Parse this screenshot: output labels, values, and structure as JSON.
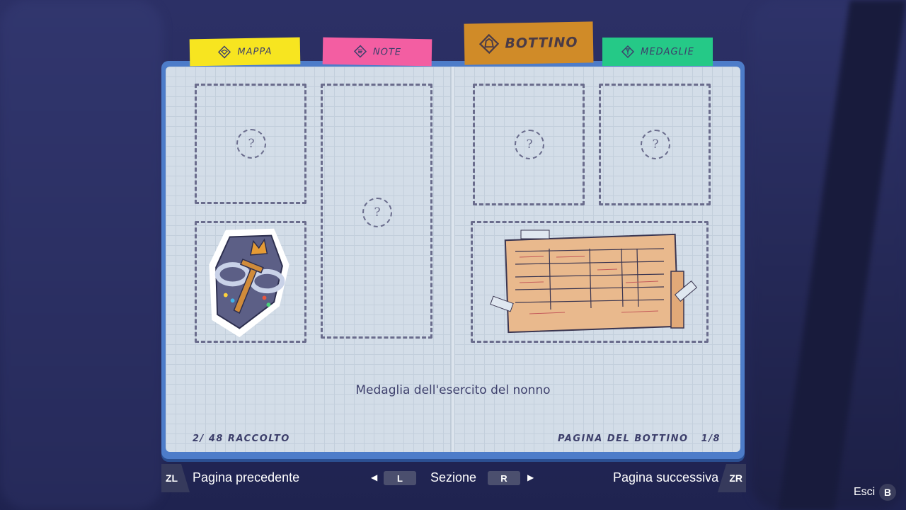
{
  "tabs": [
    {
      "label": "MAPPA",
      "icon": "map-icon",
      "color": "#f7e520"
    },
    {
      "label": "NOTE",
      "icon": "notes-icon",
      "color": "#f35ea2"
    },
    {
      "label": "BOTTINO",
      "icon": "loot-bag-icon",
      "color": "#d08b28",
      "active": true
    },
    {
      "label": "MEDAGLIE",
      "icon": "medal-icon",
      "color": "#25c987"
    }
  ],
  "slots": {
    "unknown_mark": "?"
  },
  "caption": "Medaglia dell'esercito del nonno",
  "footer": {
    "collected": "2/ 48 RACCOLTO",
    "page_info": "PAGINA DEL BOTTINO   1/8"
  },
  "controls": {
    "zl": "ZL",
    "prev": "Pagina precedente",
    "l": "L",
    "section": "Sezione",
    "r": "R",
    "next": "Pagina successiva",
    "zr": "ZR",
    "exit": "Esci",
    "b": "B"
  },
  "colors": {
    "notebook": "#4d7cc9",
    "page": "#d3dde8",
    "ink": "#3d3f6b",
    "background": "#2c3066"
  }
}
